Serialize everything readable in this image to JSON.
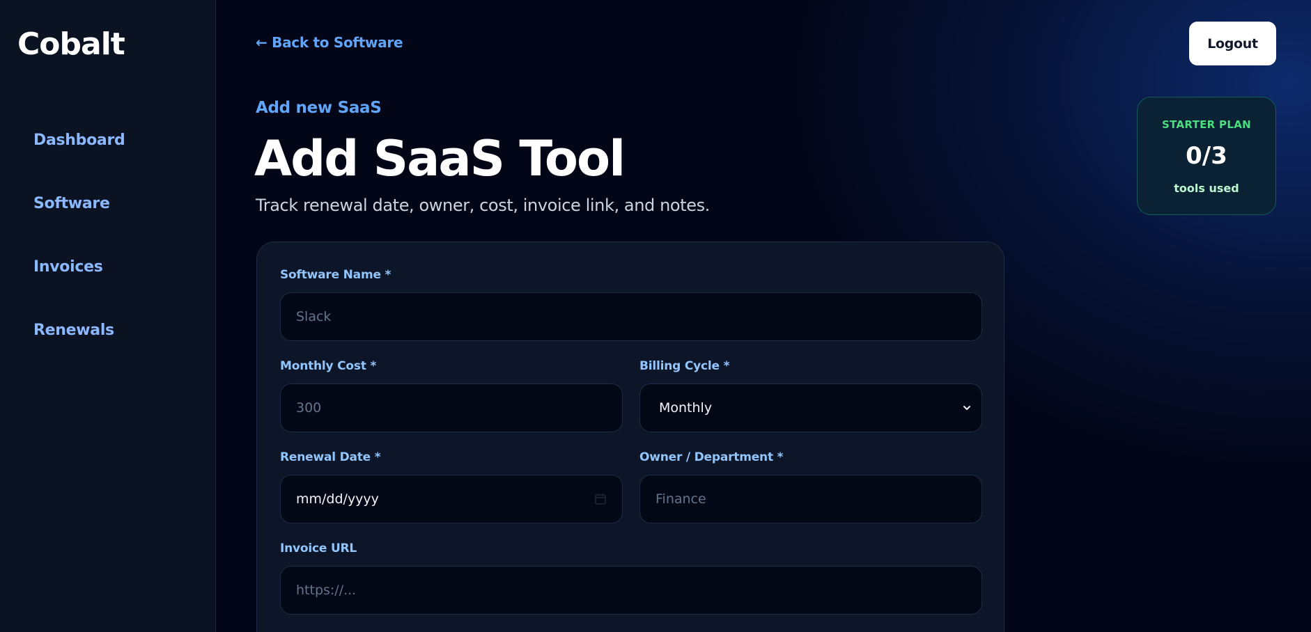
{
  "app": {
    "brand": "Cobalt"
  },
  "sidebar": {
    "items": [
      {
        "label": "Dashboard"
      },
      {
        "label": "Software"
      },
      {
        "label": "Invoices"
      },
      {
        "label": "Renewals"
      }
    ]
  },
  "header": {
    "back_link": "← Back to Software",
    "logout_label": "Logout"
  },
  "plan": {
    "name": "STARTER PLAN",
    "usage": "0/3",
    "usage_label": "tools used"
  },
  "page": {
    "eyebrow": "Add new SaaS",
    "title": "Add SaaS Tool",
    "subtitle": "Track renewal date, owner, cost, invoice link, and notes."
  },
  "form": {
    "software_name": {
      "label": "Software Name *",
      "placeholder": "Slack",
      "value": ""
    },
    "monthly_cost": {
      "label": "Monthly Cost *",
      "placeholder": "300",
      "value": ""
    },
    "billing_cycle": {
      "label": "Billing Cycle *",
      "selected": "Monthly"
    },
    "renewal_date": {
      "label": "Renewal Date *",
      "value": "mm/dd/yyyy"
    },
    "owner": {
      "label": "Owner / Department *",
      "placeholder": "Finance",
      "value": ""
    },
    "invoice_url": {
      "label": "Invoice URL",
      "placeholder": "https://...",
      "value": ""
    }
  },
  "colors": {
    "accent": "#60a5fa",
    "nav": "#8bb8ff",
    "plan_accent": "#4ade80",
    "background": "#020617",
    "card": "#0d1628"
  }
}
